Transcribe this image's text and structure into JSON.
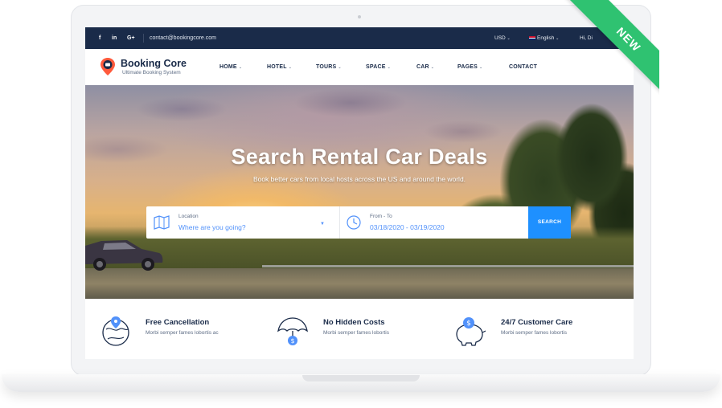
{
  "topbar": {
    "social": [
      "f",
      "in",
      "G+"
    ],
    "email": "contact@bookingcore.com",
    "currency": "USD",
    "language": "English",
    "greeting": "Hi, Di"
  },
  "brand": {
    "name": "Booking Core",
    "tagline": "Ultimate Booking System"
  },
  "nav": [
    "HOME",
    "HOTEL",
    "TOURS",
    "SPACE",
    "CAR",
    "PAGES",
    "CONTACT"
  ],
  "hero": {
    "title": "Search Rental Car Deals",
    "subtitle": "Book better cars from local hosts across the US and around the world."
  },
  "search": {
    "location_label": "Location",
    "location_placeholder": "Where are you going?",
    "date_label": "From - To",
    "date_value": "03/18/2020 - 03/19/2020",
    "button": "SEARCH"
  },
  "features": [
    {
      "title": "Free Cancellation",
      "desc": "Morbi semper fames lobortis ac",
      "icon": "globe-pin-icon"
    },
    {
      "title": "No Hidden Costs",
      "desc": "Morbi semper fames lobortis",
      "icon": "umbrella-coin-icon"
    },
    {
      "title": "24/7 Customer Care",
      "desc": "Morbi semper fames lobortis",
      "icon": "piggy-bank-icon"
    }
  ],
  "badge": "NEW",
  "colors": {
    "navy": "#1a2b49",
    "accent_blue": "#1e90ff",
    "ribbon_green": "#2fc271",
    "link_blue": "#5191fa"
  }
}
